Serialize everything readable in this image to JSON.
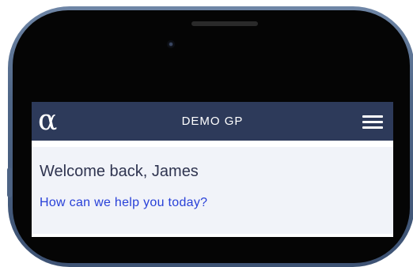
{
  "header": {
    "logo_glyph": "α",
    "title": "DEMO GP",
    "menu_icon": "hamburger-menu-icon"
  },
  "welcome": {
    "greeting": "Welcome back, James",
    "help_link": "How can we help you today?"
  },
  "colors": {
    "header_bg": "#2d3a5a",
    "panel_bg": "#f1f3f9",
    "link": "#2840d8",
    "greeting_text": "#2f3450"
  }
}
